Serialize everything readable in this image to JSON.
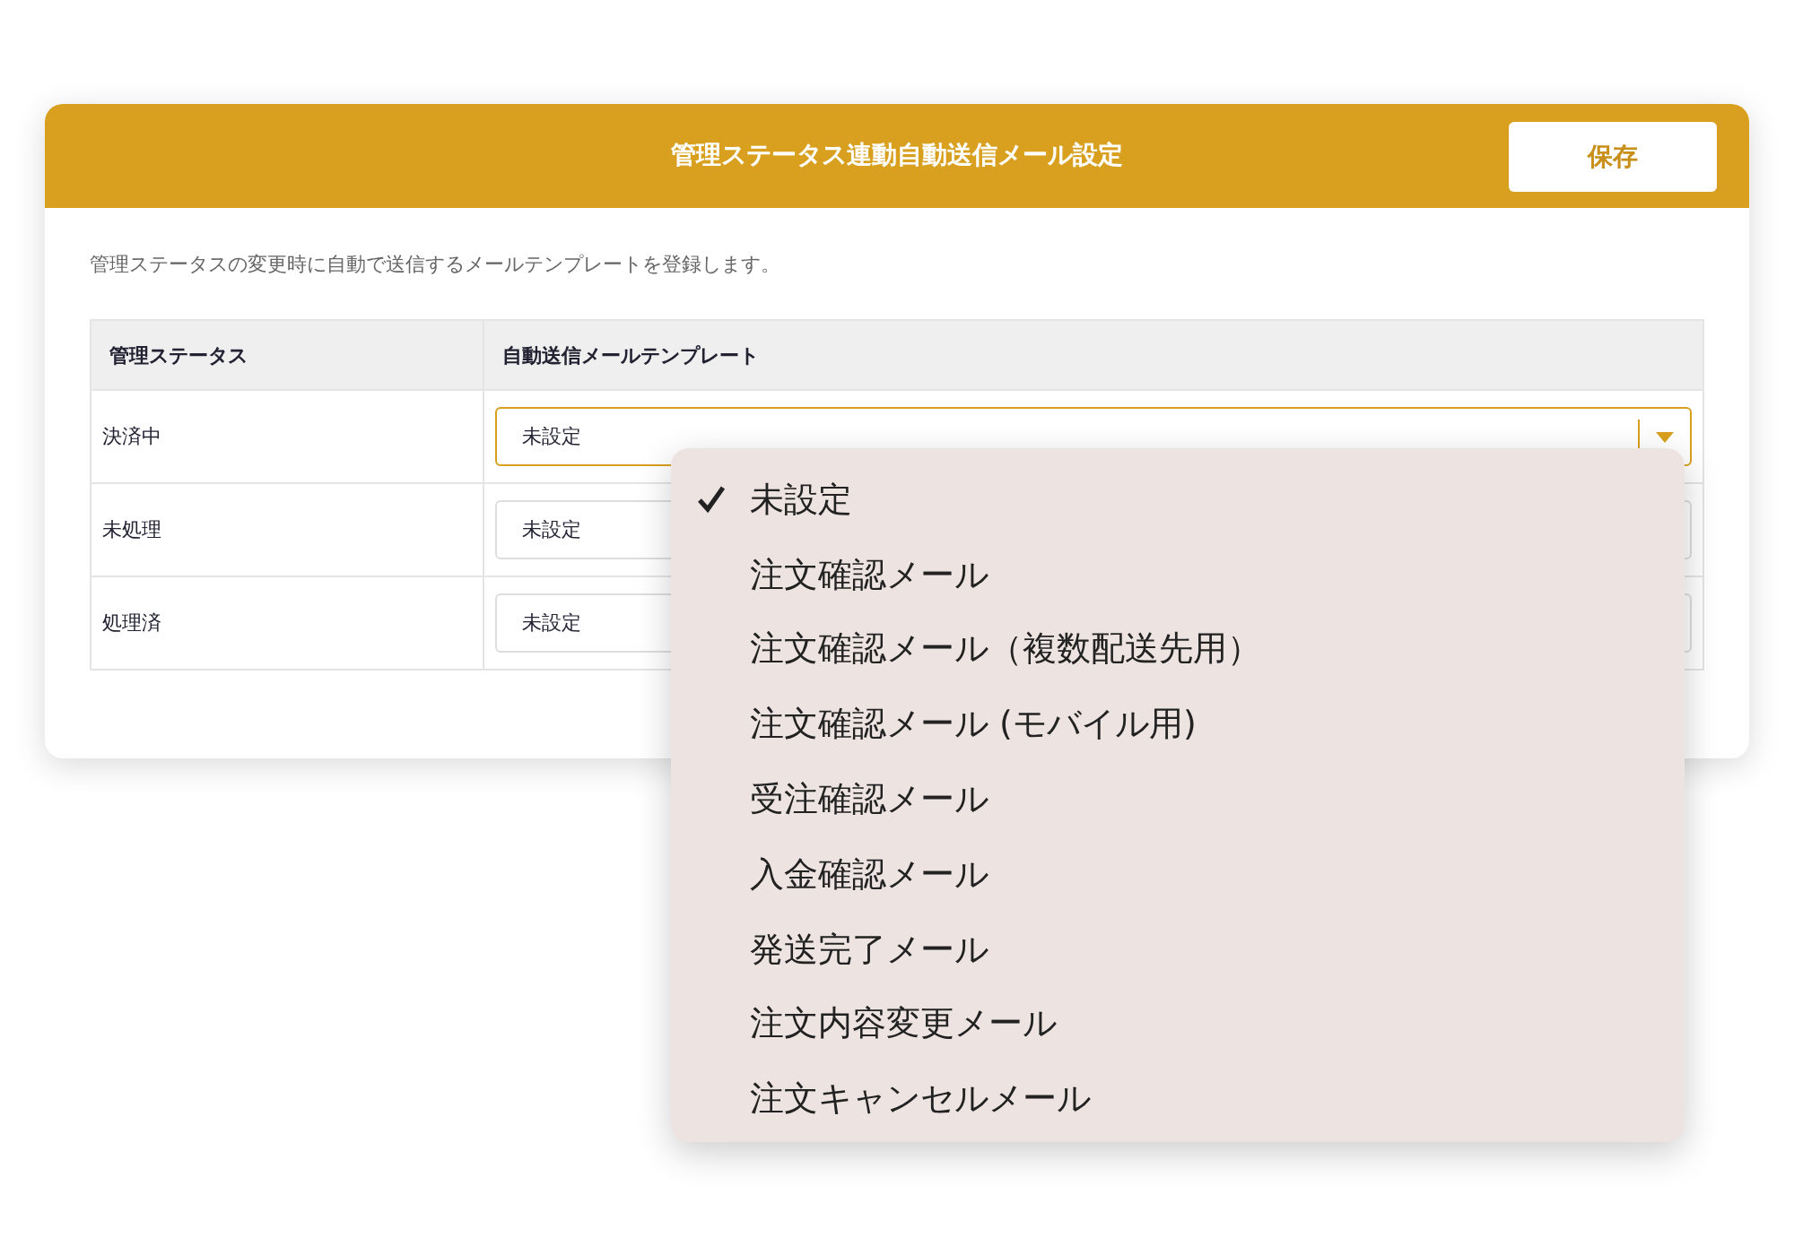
{
  "header": {
    "title": "管理ステータス連動自動送信メール設定",
    "save_button": "保存"
  },
  "description": "管理ステータスの変更時に自動で送信するメールテンプレートを登録します。",
  "table": {
    "columns": [
      "管理ステータス",
      "自動送信メールテンプレート"
    ],
    "rows": [
      {
        "status": "決済中",
        "template": "未設定",
        "open": true
      },
      {
        "status": "未処理",
        "template": "未設定",
        "open": false
      },
      {
        "status": "処理済",
        "template": "未設定",
        "open": false
      }
    ]
  },
  "dropdown_options": [
    {
      "label": "未設定",
      "selected": true
    },
    {
      "label": "注文確認メール",
      "selected": false
    },
    {
      "label": "注文確認メール（複数配送先用）",
      "selected": false
    },
    {
      "label": "注文確認メール (モバイル用)",
      "selected": false
    },
    {
      "label": "受注確認メール",
      "selected": false
    },
    {
      "label": "入金確認メール",
      "selected": false
    },
    {
      "label": "発送完了メール",
      "selected": false
    },
    {
      "label": "注文内容変更メール",
      "selected": false
    },
    {
      "label": "注文キャンセルメール",
      "selected": false
    }
  ]
}
